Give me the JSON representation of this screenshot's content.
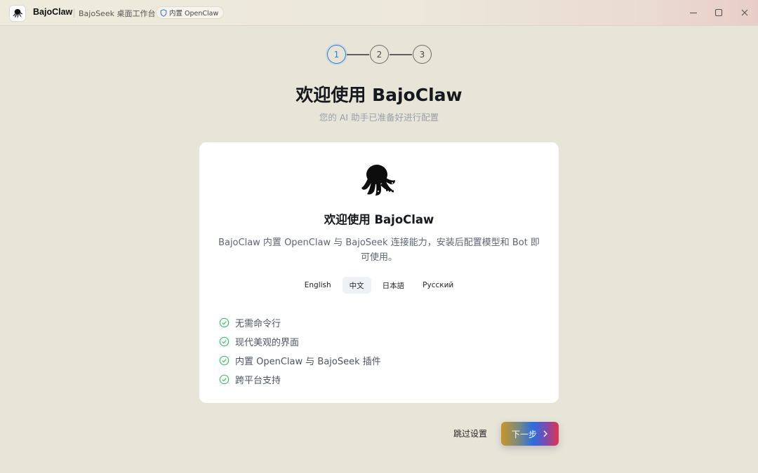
{
  "titlebar": {
    "app_name": "BajoClaw",
    "subtitle": "BajoSeek 桌面工作台",
    "badge": "内置 OpenClaw",
    "window_controls": [
      "minimize-icon",
      "maximize-icon",
      "close-icon"
    ]
  },
  "stepper": {
    "steps": [
      "1",
      "2",
      "3"
    ],
    "current": 1,
    "active_color": "#2b7be0"
  },
  "header": {
    "title": "欢迎使用 BajoClaw",
    "subtitle": "您的 AI 助手已准备好进行配置"
  },
  "card": {
    "logo_icon": "octopus-logo-icon",
    "title": "欢迎使用 BajoClaw",
    "description": "BajoClaw 内置 OpenClaw 与 BajoSeek 连接能力，安装后配置模型和 Bot 即可使用。",
    "languages": [
      "English",
      "中文",
      "日本語",
      "Русский"
    ],
    "selected_language": "中文",
    "features": [
      "无需命令行",
      "现代美观的界面",
      "内置 OpenClaw 与 BajoSeek 插件",
      "跨平台支持"
    ],
    "check_color": "#3fbf6b"
  },
  "actions": {
    "skip_label": "跳过设置",
    "next_label": "下一步"
  }
}
